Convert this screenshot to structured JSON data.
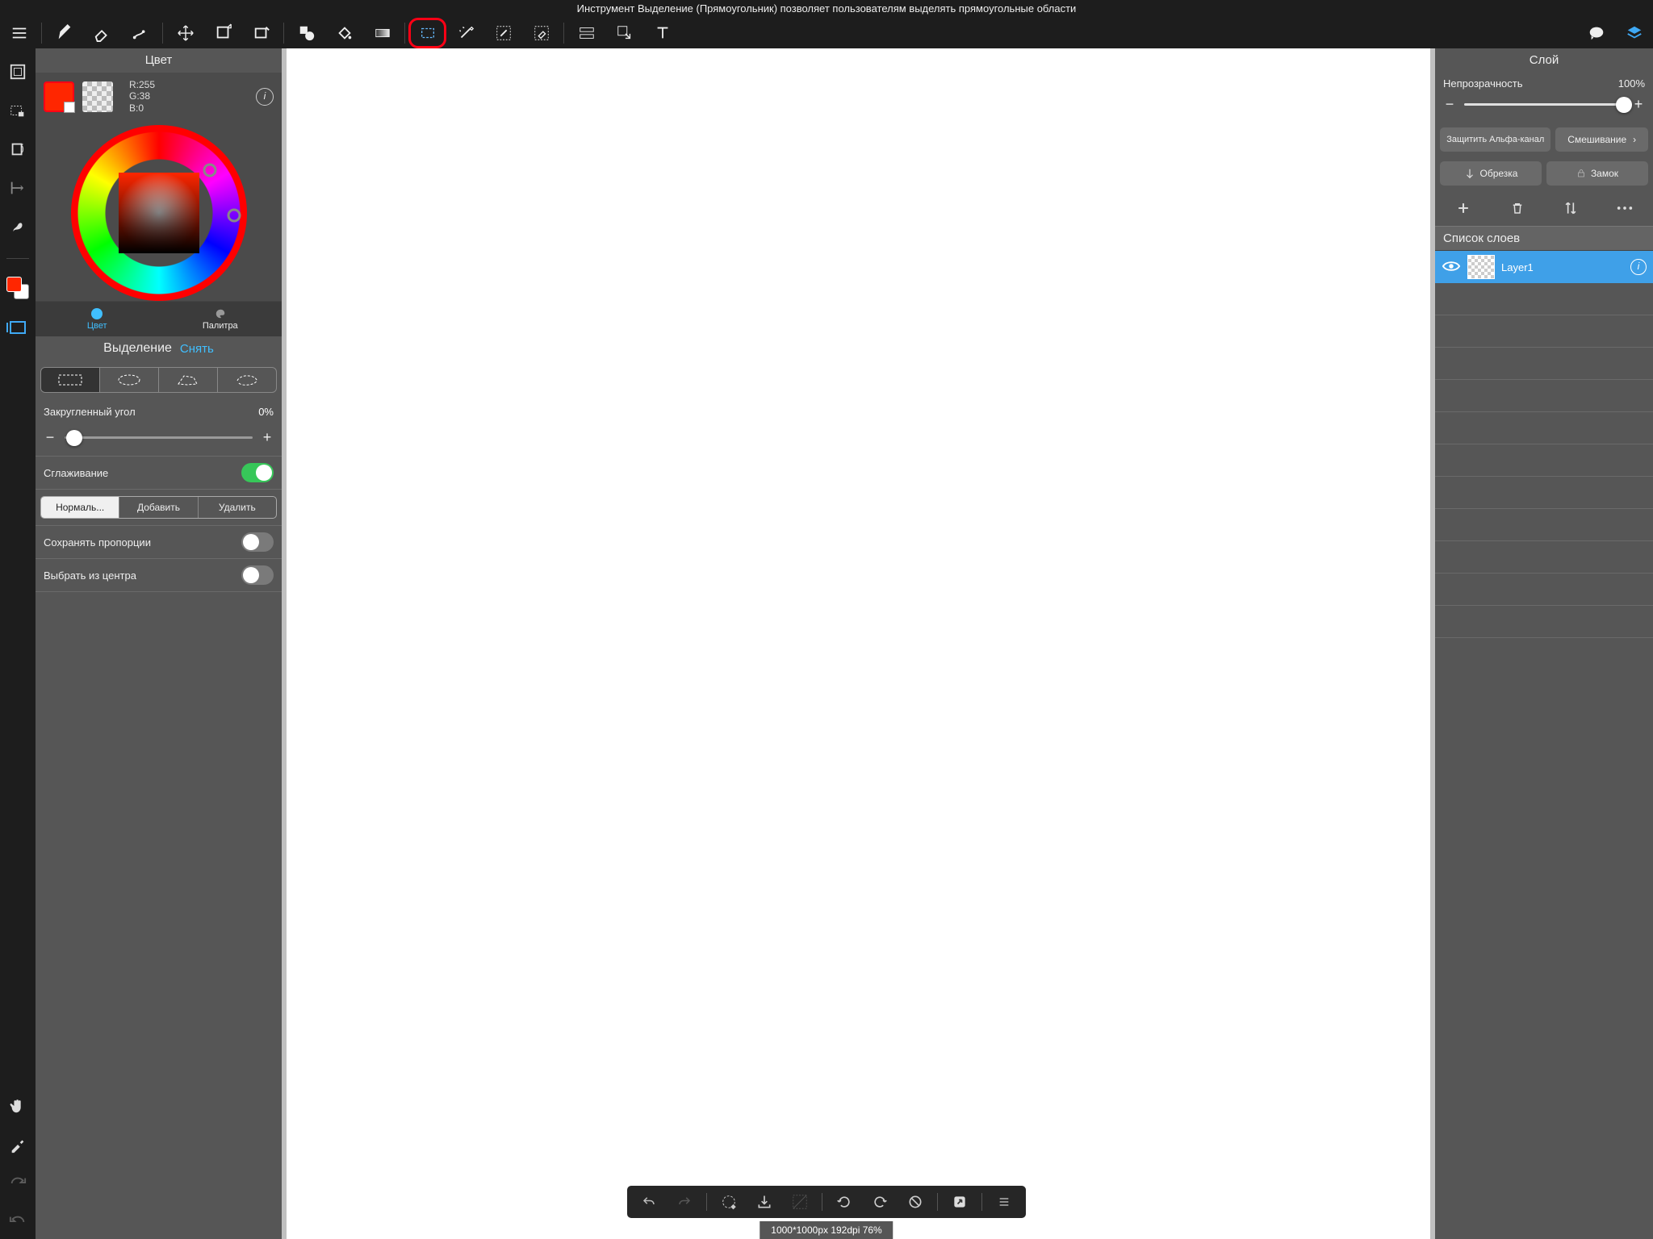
{
  "tooltip": "Инструмент Выделение (Прямоугольник) позволяет пользователям выделять прямоугольные области",
  "color": {
    "title": "Цвет",
    "rgb": {
      "r": "R:255",
      "g": "G:38",
      "b": "B:0"
    },
    "tab_color": "Цвет",
    "tab_palette": "Палитра"
  },
  "selection": {
    "title": "Выделение",
    "deselect": "Снять",
    "corner_label": "Закругленный угол",
    "corner_value": "0%",
    "antialias": "Сглаживание",
    "mode_normal": "Нормаль...",
    "mode_add": "Добавить",
    "mode_del": "Удалить",
    "keep_ratio": "Сохранять пропорции",
    "from_center": "Выбрать из центра"
  },
  "layer": {
    "title": "Слой",
    "opacity_label": "Непрозрачность",
    "opacity_value": "100%",
    "protect_alpha": "Защитить Альфа-канал",
    "blend": "Смешивание",
    "crop": "Обрезка",
    "lock": "Замок",
    "list_title": "Список слоев",
    "item1": "Layer1"
  },
  "status": "1000*1000px 192dpi 76%"
}
